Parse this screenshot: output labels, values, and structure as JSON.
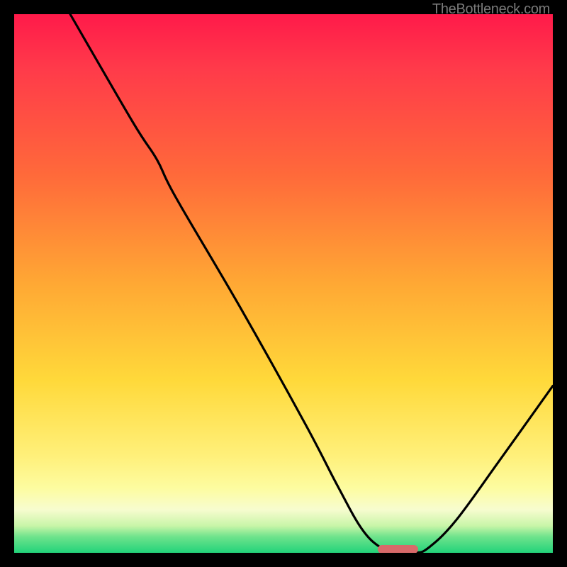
{
  "watermark": "TheBottleneck.com",
  "chart_data": {
    "type": "line",
    "title": "",
    "xlabel": "",
    "ylabel": "",
    "xlim": [
      0,
      100
    ],
    "ylim": [
      0,
      100
    ],
    "grid": false,
    "legend": false,
    "background_gradient": {
      "direction": "vertical",
      "stops": [
        {
          "pos": 0,
          "color": "#ff1a4a"
        },
        {
          "pos": 10,
          "color": "#ff3a4a"
        },
        {
          "pos": 30,
          "color": "#ff6a3a"
        },
        {
          "pos": 50,
          "color": "#ffa834"
        },
        {
          "pos": 68,
          "color": "#ffd93a"
        },
        {
          "pos": 82,
          "color": "#fff07a"
        },
        {
          "pos": 88,
          "color": "#fdfca0"
        },
        {
          "pos": 92,
          "color": "#f7fccf"
        },
        {
          "pos": 95,
          "color": "#c8f5a8"
        },
        {
          "pos": 97,
          "color": "#6fe38c"
        },
        {
          "pos": 100,
          "color": "#22d37a"
        }
      ]
    },
    "series": [
      {
        "name": "bottleneck-curve",
        "color": "#000000",
        "points": [
          {
            "x": 10.4,
            "y": 100.0
          },
          {
            "x": 22.0,
            "y": 80.0
          },
          {
            "x": 26.5,
            "y": 73.0
          },
          {
            "x": 30.0,
            "y": 66.0
          },
          {
            "x": 42.0,
            "y": 45.5
          },
          {
            "x": 54.0,
            "y": 24.0
          },
          {
            "x": 60.0,
            "y": 12.5
          },
          {
            "x": 64.5,
            "y": 4.5
          },
          {
            "x": 68.0,
            "y": 1.0
          },
          {
            "x": 71.0,
            "y": 0.0
          },
          {
            "x": 74.5,
            "y": 0.0
          },
          {
            "x": 77.0,
            "y": 1.0
          },
          {
            "x": 82.0,
            "y": 6.0
          },
          {
            "x": 90.0,
            "y": 17.0
          },
          {
            "x": 100.0,
            "y": 31.0
          }
        ]
      }
    ],
    "annotations": [
      {
        "name": "optimal-range-marker",
        "type": "bar-marker",
        "x_start": 67.5,
        "x_end": 75.0,
        "y": 0.0,
        "color": "#d86a6a"
      }
    ]
  }
}
